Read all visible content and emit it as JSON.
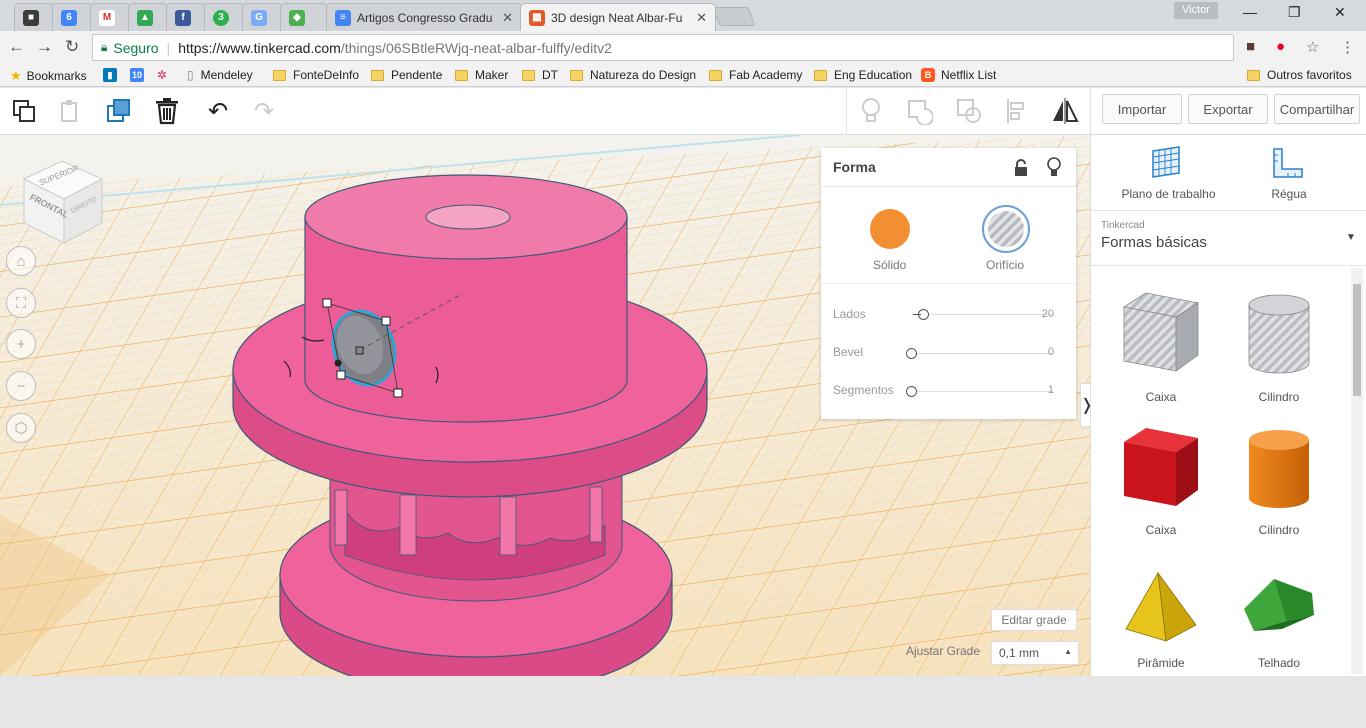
{
  "browser": {
    "tabs": [
      {
        "title": "",
        "color": "#3b3b3b",
        "glyph": "■"
      },
      {
        "title": "",
        "color": "#4285f4",
        "glyph": "6"
      },
      {
        "title": "",
        "color": "#ffffff",
        "glyph": "M"
      },
      {
        "title": "",
        "color": "#34a853",
        "glyph": "▲"
      },
      {
        "title": "",
        "color": "#3b5998",
        "glyph": "f"
      },
      {
        "title": "",
        "color": "#2bb24c",
        "glyph": "3"
      },
      {
        "title": "",
        "color": "#7baaf7",
        "glyph": "G"
      },
      {
        "title": "",
        "color": "#4caf50",
        "glyph": "◆"
      },
      {
        "title": "Artigos Congresso Gradu",
        "color": "#4285f4",
        "glyph": "≡"
      },
      {
        "title": "3D design Neat Albar-Fu",
        "color": "#e0592a",
        "glyph": "▦"
      }
    ],
    "profile_name": "Victor",
    "security_label": "Seguro",
    "url_host": "https://www.tinkercad.com",
    "url_path": "/things/06SBtleRWjq-neat-albar-fulffy/editv2"
  },
  "bookmarks": {
    "items": [
      "Bookmarks",
      "10",
      "Mendeley",
      "FonteDeInfo",
      "Pendente",
      "Maker",
      "DT",
      "Natureza do Design",
      "Fab Academy",
      "Eng Education",
      "Netflix List"
    ],
    "other": "Outros favoritos"
  },
  "app_toolbar": {
    "import_label": "Importar",
    "export_label": "Exportar",
    "share_label": "Compartilhar"
  },
  "viewcube": {
    "top": "SUPERIOR",
    "front": "FRONTAL",
    "right": "DIREITO"
  },
  "shape_panel": {
    "title": "Forma",
    "solid_label": "Sólido",
    "hole_label": "Orifício",
    "solid_color": "#f28f33",
    "params": [
      {
        "label": "Lados",
        "value": "20",
        "level": 0.02
      },
      {
        "label": "Bevel",
        "value": "0",
        "level": 0
      },
      {
        "label": "Segmentos",
        "value": "1",
        "level": 0
      }
    ]
  },
  "grid": {
    "edit_label": "Editar grade",
    "snap_label": "Ajustar Grade",
    "snap_value": "0,1 mm"
  },
  "sidebar": {
    "workplane_label": "Plano de trabalho",
    "ruler_label": "Régua",
    "category_label": "Tinkercad",
    "library_label": "Formas básicas",
    "shapes": [
      {
        "label": "Caixa",
        "icon": "box-hole-icon"
      },
      {
        "label": "Cilindro",
        "icon": "cylinder-hole-icon"
      },
      {
        "label": "Caixa",
        "icon": "box-red-icon"
      },
      {
        "label": "Cilindro",
        "icon": "cylinder-orange-icon"
      },
      {
        "label": "Pirâmide",
        "icon": "pyramid-yellow-icon"
      },
      {
        "label": "Telhado",
        "icon": "roof-green-icon"
      }
    ]
  },
  "colors": {
    "model_pink": "#ee5e98",
    "grid_orange": "#f3b660",
    "selection_blue": "#1fa9df"
  }
}
